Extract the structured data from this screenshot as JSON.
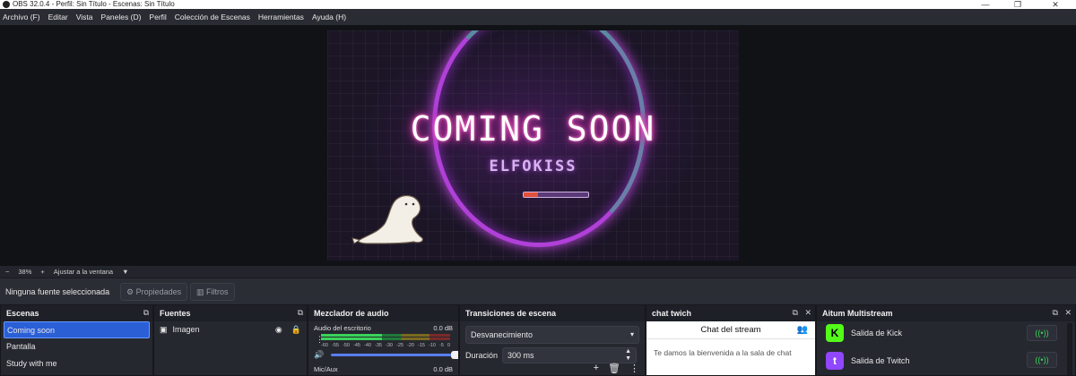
{
  "window": {
    "title": "OBS 32.0.4 - Perfil: Sin Título - Escenas: Sin Título",
    "buttons": {
      "minimize": "—",
      "restore": "❐",
      "close": "✕"
    }
  },
  "menu": [
    "Archivo (F)",
    "Editar",
    "Vista",
    "Paneles (D)",
    "Perfil",
    "Colección de Escenas",
    "Herramientas",
    "Ayuda (H)"
  ],
  "preview": {
    "headline": "COMING SOON",
    "streamer": "ELFOKISS",
    "loading_fraction": 0.22
  },
  "zoom": {
    "minus": "−",
    "level": "38%",
    "plus": "+",
    "fit_label": "Ajustar a la ventana",
    "caret": "▼"
  },
  "source_toolbar": {
    "no_source": "Ninguna fuente seleccionada",
    "properties": "Propiedades",
    "filters": "Filtros"
  },
  "scenes": {
    "title": "Escenas",
    "items": [
      "Coming soon",
      "Pantalla",
      "Study with me"
    ]
  },
  "sources": {
    "title": "Fuentes",
    "items": [
      {
        "label": "Imagen"
      }
    ]
  },
  "mixer": {
    "title": "Mezclador de audio",
    "channels": [
      {
        "name": "Audio del escritorio",
        "db": "0.0 dB",
        "level_fraction": 0.47
      },
      {
        "name": "Mic/Aux",
        "db": "0.0 dB",
        "level_fraction": 0.0
      }
    ],
    "scale": [
      "-60",
      "-55",
      "-50",
      "-45",
      "-40",
      "-35",
      "-30",
      "-25",
      "-20",
      "-15",
      "-10",
      "-5",
      "0"
    ],
    "volume_fraction": 1.0
  },
  "transitions": {
    "title": "Transiciones de escena",
    "selected": "Desvanecimiento",
    "duration_label": "Duración",
    "duration_value": "300 ms"
  },
  "chat": {
    "title": "chat twich",
    "header": "Chat del stream",
    "welcome": "Te damos la bienvenida a la sala de chat"
  },
  "multistream": {
    "title": "Aitum Multistream",
    "outputs": [
      {
        "label": "Salida de Kick",
        "logo": "K",
        "color": "#53fc18"
      },
      {
        "label": "Salida de Twitch",
        "logo": "t",
        "color": "#9146ff"
      }
    ]
  },
  "colors": {
    "accent": "#2a5fd6",
    "meter_green": "#3ad45a",
    "neon_pink": "#e03cb0"
  }
}
